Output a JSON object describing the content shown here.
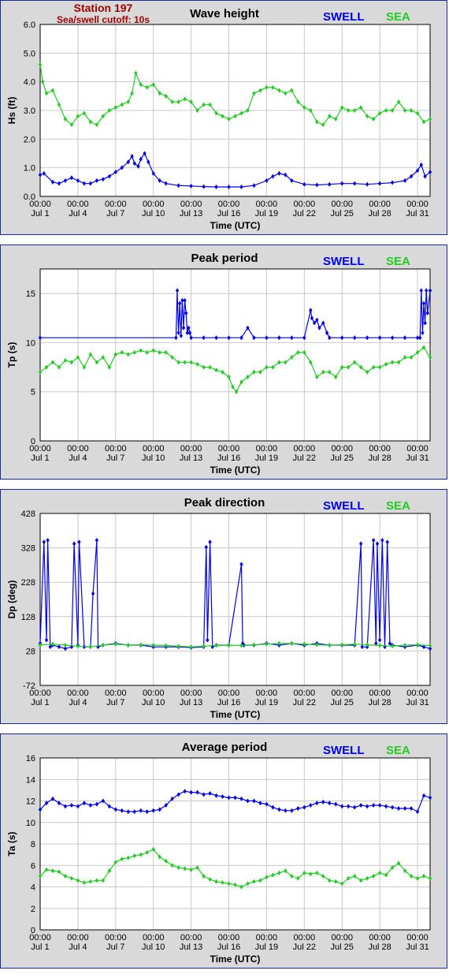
{
  "header": {
    "station": "Station 197",
    "cutoff": "Sea/swell cutoff: 10s"
  },
  "legend": {
    "swell_label": "SWELL",
    "sea_label": "SEA",
    "swell_color": "#0000ee",
    "sea_color": "#22cc22"
  },
  "x_axis": {
    "label": "Time (UTC)",
    "tick_time": "00:00",
    "tick_dates": [
      "Jul 1",
      "Jul 4",
      "Jul 7",
      "Jul 10",
      "Jul 13",
      "Jul 16",
      "Jul 19",
      "Jul 22",
      "Jul 25",
      "Jul 28",
      "Jul 31"
    ],
    "tick_days": [
      0,
      3,
      6,
      9,
      12,
      15,
      18,
      21,
      24,
      27,
      30
    ],
    "range_days": [
      0,
      31
    ]
  },
  "chart_data": [
    {
      "type": "scatter",
      "title": "Wave height",
      "ylabel": "Hs (ft)",
      "xlabel": "Time (UTC)",
      "ylim": [
        0,
        6
      ],
      "yticks": [
        "0.0",
        "1.0",
        "2.0",
        "3.0",
        "4.0",
        "5.0",
        "6.0"
      ],
      "ytick_values": [
        0,
        1,
        2,
        3,
        4,
        5,
        6
      ],
      "grid": true,
      "series": [
        {
          "name": "SWELL",
          "x": [
            0,
            0.3,
            1,
            1.5,
            2,
            2.5,
            3,
            3.5,
            4,
            4.5,
            5,
            5.5,
            6,
            6.5,
            7,
            7.3,
            7.5,
            7.8,
            8,
            8.3,
            8.6,
            9,
            9.5,
            10,
            11,
            12,
            13,
            14,
            15,
            16,
            17,
            18,
            18.5,
            19,
            19.5,
            20,
            21,
            22,
            23,
            24,
            25,
            26,
            27,
            28,
            29,
            29.5,
            30,
            30.3,
            30.6,
            31
          ],
          "values": [
            0.75,
            0.8,
            0.5,
            0.45,
            0.55,
            0.65,
            0.55,
            0.45,
            0.45,
            0.55,
            0.6,
            0.7,
            0.85,
            1.0,
            1.2,
            1.4,
            1.15,
            1.05,
            1.3,
            1.5,
            1.2,
            0.8,
            0.55,
            0.45,
            0.38,
            0.36,
            0.34,
            0.33,
            0.33,
            0.33,
            0.38,
            0.55,
            0.7,
            0.8,
            0.75,
            0.55,
            0.42,
            0.4,
            0.42,
            0.45,
            0.45,
            0.42,
            0.45,
            0.48,
            0.55,
            0.7,
            0.9,
            1.1,
            0.7,
            0.85
          ]
        },
        {
          "name": "SEA",
          "x": [
            0,
            0.2,
            0.5,
            1,
            1.5,
            2,
            2.5,
            3,
            3.5,
            4,
            4.5,
            5,
            5.5,
            6,
            6.5,
            7,
            7.3,
            7.6,
            8,
            8.5,
            9,
            9.5,
            10,
            10.5,
            11,
            11.5,
            12,
            12.5,
            13,
            13.5,
            14,
            14.5,
            15,
            15.5,
            16,
            16.5,
            17,
            17.5,
            18,
            18.5,
            19,
            19.5,
            20,
            20.5,
            21,
            21.5,
            22,
            22.5,
            23,
            23.5,
            24,
            24.5,
            25,
            25.5,
            26,
            26.5,
            27,
            27.5,
            28,
            28.5,
            29,
            29.5,
            30,
            30.5,
            31
          ],
          "values": [
            4.6,
            4.0,
            3.6,
            3.7,
            3.2,
            2.7,
            2.5,
            2.8,
            2.9,
            2.6,
            2.5,
            2.8,
            3.0,
            3.1,
            3.2,
            3.3,
            3.6,
            4.3,
            3.9,
            3.8,
            3.9,
            3.6,
            3.5,
            3.3,
            3.3,
            3.4,
            3.3,
            3.0,
            3.2,
            3.2,
            2.9,
            2.8,
            2.7,
            2.8,
            2.9,
            3.0,
            3.6,
            3.7,
            3.8,
            3.8,
            3.7,
            3.6,
            3.7,
            3.3,
            3.1,
            3.0,
            2.6,
            2.5,
            2.8,
            2.7,
            3.1,
            3.0,
            3.0,
            3.1,
            2.8,
            2.7,
            2.9,
            3.0,
            3.0,
            3.3,
            3.0,
            3.0,
            2.9,
            2.6,
            2.7
          ]
        }
      ]
    },
    {
      "type": "scatter",
      "title": "Peak period",
      "ylabel": "Tp (s)",
      "xlabel": "Time (UTC)",
      "ylim": [
        0,
        17.5
      ],
      "yticks": [
        "0",
        "5",
        "10",
        "15"
      ],
      "ytick_values": [
        0,
        5,
        10,
        15
      ],
      "grid": true,
      "series": [
        {
          "name": "SWELL",
          "x": [
            0,
            10.8,
            10.9,
            11.0,
            11.1,
            11.2,
            11.3,
            11.4,
            11.5,
            11.6,
            11.7,
            11.8,
            11.9,
            12.0,
            13.0,
            14.0,
            15.0,
            16.0,
            16.5,
            17.0,
            18.0,
            19.0,
            20.0,
            21.0,
            21.5,
            21.6,
            21.8,
            22.0,
            22.2,
            22.5,
            22.8,
            23.0,
            24.0,
            25.0,
            26.0,
            27.0,
            28.0,
            29.0,
            30.0,
            30.2,
            30.3,
            30.4,
            30.5,
            30.6,
            30.7,
            30.8,
            31.0
          ],
          "values": [
            10.5,
            10.5,
            15.3,
            11.0,
            14.0,
            10.7,
            14.3,
            11.5,
            14.3,
            13.0,
            11.0,
            11.5,
            11.0,
            10.5,
            10.5,
            10.5,
            10.5,
            10.5,
            11.5,
            10.5,
            10.5,
            10.5,
            10.5,
            10.5,
            13.3,
            12.5,
            12.0,
            12.3,
            11.5,
            12.0,
            11.0,
            10.5,
            10.5,
            10.5,
            10.5,
            10.5,
            10.5,
            10.5,
            10.5,
            10.5,
            15.3,
            11.0,
            14.0,
            12.0,
            15.3,
            13.0,
            15.3
          ]
        },
        {
          "name": "SEA",
          "x": [
            0,
            0.5,
            1,
            1.5,
            2,
            2.5,
            3,
            3.5,
            4,
            4.5,
            5,
            5.5,
            6,
            6.5,
            7,
            7.5,
            8,
            8.5,
            9,
            9.5,
            10,
            10.5,
            11,
            11.5,
            12,
            12.5,
            13,
            13.5,
            14,
            14.5,
            15,
            15.3,
            15.6,
            16,
            16.5,
            17,
            17.5,
            18,
            18.5,
            19,
            19.5,
            20,
            20.5,
            21,
            21.5,
            22,
            22.5,
            23,
            23.5,
            24,
            24.5,
            25,
            25.5,
            26,
            26.5,
            27,
            27.5,
            28,
            28.5,
            29,
            29.5,
            30,
            30.5,
            31
          ],
          "values": [
            7.0,
            7.5,
            8.0,
            7.5,
            8.2,
            8.0,
            8.5,
            7.5,
            8.8,
            8.0,
            8.5,
            7.5,
            8.8,
            9.0,
            8.8,
            9.0,
            9.2,
            9.0,
            9.2,
            9.0,
            9.0,
            8.5,
            8.0,
            8.0,
            8.0,
            7.8,
            7.5,
            7.5,
            7.2,
            7.0,
            6.5,
            5.5,
            5.0,
            6.0,
            6.5,
            7.0,
            7.0,
            7.5,
            7.5,
            8.0,
            8.0,
            8.5,
            9.0,
            9.0,
            8.0,
            6.5,
            7.0,
            7.0,
            6.5,
            7.5,
            7.5,
            8.0,
            7.5,
            7.0,
            7.5,
            7.5,
            7.8,
            8.0,
            8.0,
            8.5,
            8.5,
            9.0,
            9.5,
            8.5
          ]
        }
      ]
    },
    {
      "type": "scatter",
      "title": "Peak direction",
      "ylabel": "Dp (deg)",
      "xlabel": "Time (UTC)",
      "ylim": [
        -72,
        428
      ],
      "yticks": [
        "-72",
        "28",
        "128",
        "228",
        "328",
        "428"
      ],
      "ytick_values": [
        -72,
        28,
        128,
        228,
        328,
        428
      ],
      "grid": true,
      "series": [
        {
          "name": "SWELL",
          "x": [
            0,
            0.3,
            0.5,
            0.6,
            0.8,
            1.0,
            1.5,
            2.0,
            2.5,
            2.7,
            3.0,
            3.1,
            3.5,
            4.0,
            4.2,
            4.5,
            4.6,
            5.0,
            6.0,
            7.0,
            8.0,
            9.0,
            10.0,
            11.0,
            12.0,
            13.0,
            13.2,
            13.3,
            13.5,
            13.7,
            14.0,
            15.0,
            16.0,
            16.1,
            16.2,
            17.0,
            18.0,
            19.0,
            20.0,
            21.0,
            22.0,
            23.0,
            24.0,
            25.0,
            25.5,
            25.6,
            26.0,
            26.5,
            26.7,
            26.8,
            27.0,
            27.2,
            27.4,
            27.6,
            27.8,
            28.0,
            29.0,
            30.0,
            30.5,
            31.0
          ],
          "values": [
            50,
            345,
            60,
            350,
            40,
            45,
            40,
            35,
            40,
            340,
            45,
            345,
            40,
            40,
            195,
            350,
            40,
            45,
            50,
            45,
            45,
            40,
            40,
            40,
            38,
            40,
            330,
            60,
            345,
            40,
            45,
            45,
            280,
            50,
            45,
            45,
            50,
            45,
            50,
            45,
            50,
            45,
            45,
            45,
            340,
            40,
            40,
            350,
            50,
            340,
            60,
            350,
            40,
            345,
            50,
            45,
            40,
            45,
            40,
            35
          ]
        },
        {
          "name": "SEA",
          "x": [
            0,
            1,
            2,
            3,
            4,
            5,
            6,
            7,
            8,
            9,
            10,
            11,
            12,
            13,
            14,
            15,
            16,
            17,
            18,
            19,
            20,
            21,
            22,
            23,
            24,
            25,
            26,
            27,
            28,
            29,
            30,
            31
          ],
          "values": [
            45,
            48,
            45,
            42,
            40,
            45,
            48,
            45,
            46,
            45,
            44,
            42,
            40,
            42,
            44,
            45,
            44,
            46,
            48,
            50,
            50,
            48,
            46,
            45,
            46,
            48,
            46,
            44,
            42,
            45,
            46,
            44
          ]
        }
      ]
    },
    {
      "type": "scatter",
      "title": "Average period",
      "ylabel": "Ta (s)",
      "xlabel": "Time (UTC)",
      "ylim": [
        0,
        16
      ],
      "yticks": [
        "0",
        "2",
        "4",
        "6",
        "8",
        "10",
        "12",
        "14",
        "16"
      ],
      "ytick_values": [
        0,
        2,
        4,
        6,
        8,
        10,
        12,
        14,
        16
      ],
      "grid": true,
      "series": [
        {
          "name": "SWELL",
          "x": [
            0,
            0.5,
            1,
            1.5,
            2,
            2.5,
            3,
            3.5,
            4,
            4.5,
            5,
            5.5,
            6,
            6.5,
            7,
            7.5,
            8,
            8.5,
            9,
            9.5,
            10,
            10.5,
            11,
            11.5,
            12,
            12.5,
            13,
            13.5,
            14,
            14.5,
            15,
            15.5,
            16,
            16.5,
            17,
            17.5,
            18,
            18.5,
            19,
            19.5,
            20,
            20.5,
            21,
            21.5,
            22,
            22.5,
            23,
            23.5,
            24,
            24.5,
            25,
            25.5,
            26,
            26.5,
            27,
            27.5,
            28,
            28.5,
            29,
            29.5,
            30,
            30.5,
            31
          ],
          "values": [
            11.2,
            11.8,
            12.2,
            11.8,
            11.5,
            11.6,
            11.5,
            11.8,
            11.6,
            11.7,
            12.0,
            11.5,
            11.2,
            11.1,
            11.0,
            11.0,
            11.1,
            11.0,
            11.1,
            11.2,
            11.6,
            12.2,
            12.6,
            12.9,
            12.8,
            12.8,
            12.6,
            12.7,
            12.5,
            12.4,
            12.3,
            12.3,
            12.2,
            12.0,
            12.0,
            11.8,
            11.7,
            11.4,
            11.2,
            11.1,
            11.1,
            11.3,
            11.4,
            11.6,
            11.8,
            11.9,
            11.8,
            11.7,
            11.5,
            11.5,
            11.4,
            11.6,
            11.5,
            11.6,
            11.6,
            11.5,
            11.4,
            11.3,
            11.3,
            11.3,
            11.0,
            12.5,
            12.3
          ]
        },
        {
          "name": "SEA",
          "x": [
            0,
            0.5,
            1,
            1.5,
            2,
            2.5,
            3,
            3.5,
            4,
            4.5,
            5,
            5.5,
            6,
            6.5,
            7,
            7.5,
            8,
            8.5,
            9,
            9.5,
            10,
            10.5,
            11,
            11.5,
            12,
            12.5,
            13,
            13.5,
            14,
            14.5,
            15,
            15.5,
            16,
            16.5,
            17,
            17.5,
            18,
            18.5,
            19,
            19.5,
            20,
            20.5,
            21,
            21.5,
            22,
            22.5,
            23,
            23.5,
            24,
            24.5,
            25,
            25.5,
            26,
            26.5,
            27,
            27.5,
            28,
            28.5,
            29,
            29.5,
            30,
            30.5,
            31
          ],
          "values": [
            5.0,
            5.6,
            5.5,
            5.4,
            5.0,
            4.8,
            4.6,
            4.4,
            4.5,
            4.6,
            4.6,
            5.5,
            6.3,
            6.6,
            6.7,
            6.9,
            7.0,
            7.2,
            7.5,
            6.8,
            6.4,
            6.0,
            5.8,
            5.7,
            5.6,
            5.8,
            5.0,
            4.7,
            4.5,
            4.4,
            4.3,
            4.2,
            4.0,
            4.3,
            4.5,
            4.6,
            4.9,
            5.1,
            5.3,
            5.5,
            5.0,
            4.8,
            5.3,
            5.2,
            5.3,
            5.0,
            4.6,
            4.5,
            4.3,
            4.8,
            5.0,
            4.6,
            4.8,
            5.0,
            5.3,
            5.1,
            5.8,
            6.2,
            5.5,
            5.0,
            4.8,
            5.0,
            4.8
          ]
        }
      ]
    }
  ]
}
